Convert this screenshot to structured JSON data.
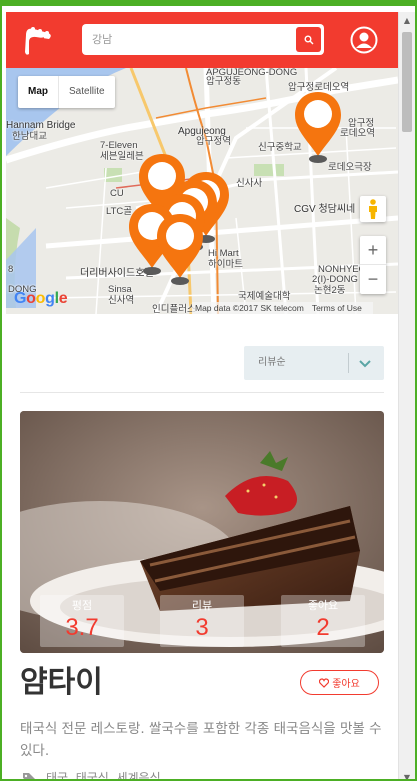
{
  "header": {
    "search_placeholder": "강남"
  },
  "map": {
    "type_controls": [
      "Map",
      "Satellite"
    ],
    "labels": {
      "apgujeong_dong": "APGUJEONG-DONG",
      "apgujeong_dong_ko": "압구정동",
      "apgujeong_4": "압구정로데오역",
      "apgujeong_rodeo": "압구정",
      "rodeo_station": "로데오역",
      "hannam_bridge": "Hannam Bridge",
      "hannam_ko": "한남대교",
      "seven_eleven": "7-Eleven",
      "seven_eleven_ko": "세븐일레븐",
      "apgujeong": "Apgujeong",
      "apgujeong_station": "압구정역",
      "sinku_school": "신구중학교",
      "rodeo_theater": "로데오극장",
      "sinsa": "신사사",
      "cu": "CU",
      "ltc": "LTC골",
      "cgv": "CGV 청담씨네",
      "hi_mart": "Hi Mart",
      "hi_mart_ko": "하이마트",
      "river_side_hotel": "더리버사이드호텔",
      "sinsa_station": "Sinsa",
      "sinsa_station_ko": "신사역",
      "indie_plaza": "인디플러스",
      "art_school": "국제예술대학",
      "nonhyeon": "NONHYEON",
      "nonhyeon_dong": "2(I)-DONG",
      "nonhyeon_ko": "논현2동",
      "dong_left": "DONG",
      "num_left": "8"
    },
    "attribution": [
      "Map data ©2017 SK telecom",
      "Terms of Use"
    ],
    "google_logo": "Google",
    "zoom_in": "+",
    "zoom_out": "−"
  },
  "sort": {
    "selected": "리뷰순"
  },
  "restaurant": {
    "stats": [
      {
        "label": "평점",
        "value": "3.7"
      },
      {
        "label": "리뷰",
        "value": "3"
      },
      {
        "label": "좋아요",
        "value": "2"
      }
    ],
    "name": "얌타이",
    "like_label": "좋아요",
    "description": "태국식 전문 레스토랑. 쌀국수를 포함한 각종 태국음식을 맛볼 수 있다.",
    "tags": "태국, 태국식, 세계음식"
  },
  "colors": {
    "brand": "#f23b2f",
    "marker": "#f5750f",
    "frame": "#4caf24"
  }
}
